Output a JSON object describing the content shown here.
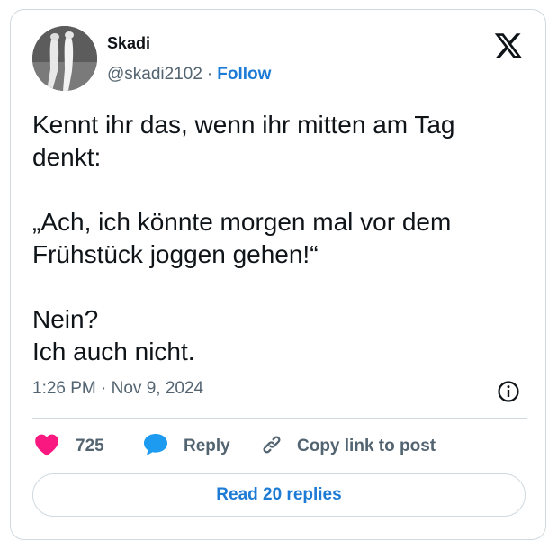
{
  "author": {
    "display_name": "Skadi",
    "handle": "@skadi2102",
    "separator": "·",
    "follow_label": "Follow"
  },
  "tweet": {
    "lines": [
      "Kennt ihr das, wenn ihr mitten am Tag denkt:",
      "„Ach, ich könnte morgen mal vor dem Frühstück joggen gehen!“",
      "Nein?",
      "Ich auch nicht."
    ],
    "timestamp": "1:26 PM · Nov 9, 2024"
  },
  "actions": {
    "like_count": "725",
    "reply_label": "Reply",
    "copy_link_label": "Copy link to post"
  },
  "read_replies_label": "Read 20 replies",
  "icons": {
    "platform_logo": "x-logo-icon",
    "info": "info-icon",
    "like": "heart-icon",
    "reply": "speech-bubble-icon",
    "copy": "link-icon"
  },
  "colors": {
    "like": "#f91880",
    "reply": "#1d9bf0",
    "link": "#1d7bd6",
    "muted": "#536471",
    "border": "#cfd9de"
  }
}
